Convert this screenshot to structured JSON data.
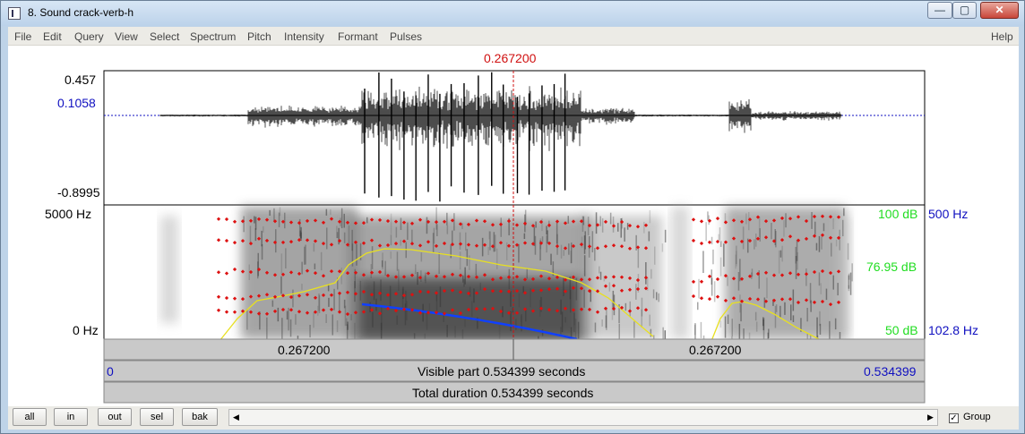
{
  "window": {
    "title": "8. Sound crack-verb-h",
    "close_glyph": "✕",
    "minimize_glyph": "—",
    "maximize_glyph": "▢"
  },
  "menu": {
    "items": [
      "File",
      "Edit",
      "Query",
      "View",
      "Select",
      "Spectrum",
      "Pitch",
      "Intensity",
      "Formant",
      "Pulses"
    ],
    "help": "Help"
  },
  "cursor": {
    "time_label": "0.267200"
  },
  "waveform": {
    "max_label": "0.457",
    "cursor_value_label": "0.1058",
    "min_label": "-0.8995"
  },
  "spectrogram": {
    "top_freq": "5000 Hz",
    "bottom_freq": "0 Hz",
    "intensity_top": "100 dB",
    "intensity_mid": "76.95 dB",
    "intensity_bottom": "50 dB",
    "pitch_top": "500 Hz",
    "pitch_bottom": "102.8 Hz"
  },
  "time_bar": {
    "left_segment": "0.267200",
    "right_segment": "0.267200",
    "visible_start": "0",
    "visible_text": "Visible part 0.534399 seconds",
    "visible_end": "0.534399",
    "total_text": "Total duration 0.534399 seconds"
  },
  "bottom": {
    "buttons": [
      "all",
      "in",
      "out",
      "sel",
      "bak"
    ],
    "group_label": "Group",
    "group_checked": true,
    "scroll_left_glyph": "◀",
    "scroll_right_glyph": "▶",
    "check_glyph": "✓"
  },
  "colors": {
    "cursor": "#d01010",
    "blue_label": "#1010c0",
    "intensity_label": "#22dd22",
    "formant_dot": "#dd1111",
    "intensity_curve": "#e8e020",
    "pitch_curve": "#1040ff"
  }
}
